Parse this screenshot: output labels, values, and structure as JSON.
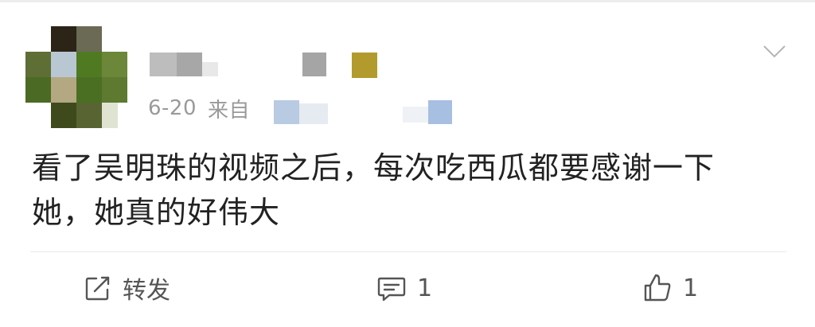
{
  "post": {
    "time": "6-20",
    "source_prefix": "来自",
    "text_line1": "看了吴明珠的视频之后，每次吃西瓜都要感谢一下",
    "text_line2": "她，她真的好伟大"
  },
  "actions": {
    "repost_label": "转发",
    "comment_count": "1",
    "like_count": "1"
  },
  "icons": {
    "menu": "chevron-down-icon",
    "repost": "repost-icon",
    "comment": "comment-icon",
    "like": "thumbs-up-icon"
  },
  "colors": {
    "text": "#222222",
    "meta": "#9a9a9a",
    "icon": "#555555",
    "divider": "#e9e9e9"
  }
}
